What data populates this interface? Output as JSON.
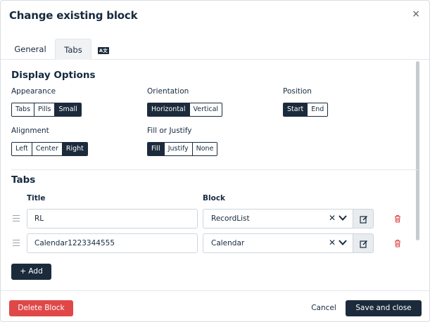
{
  "modal": {
    "title": "Change existing block",
    "close_symbol": "×"
  },
  "tabs": [
    {
      "label": "General"
    },
    {
      "label": "Tabs"
    },
    {
      "label": "A文",
      "icon": "translate-icon"
    }
  ],
  "display_options": {
    "heading": "Display Options",
    "appearance": {
      "label": "Appearance",
      "options": [
        "Tabs",
        "Pills",
        "Small"
      ],
      "selected": "Small"
    },
    "orientation": {
      "label": "Orientation",
      "options": [
        "Horizontal",
        "Vertical"
      ],
      "selected": "Horizontal"
    },
    "position": {
      "label": "Position",
      "options": [
        "Start",
        "End"
      ],
      "selected": "Start"
    },
    "alignment": {
      "label": "Alignment",
      "options": [
        "Left",
        "Center",
        "Right"
      ],
      "selected": "Right"
    },
    "fill_justify": {
      "label": "Fill or Justify",
      "options": [
        "Fill",
        "Justify",
        "None"
      ],
      "selected": "Fill"
    }
  },
  "tabs_section": {
    "heading": "Tabs",
    "col_title": "Title",
    "col_block": "Block",
    "rows": [
      {
        "title": "RL",
        "block": "RecordList"
      },
      {
        "title": "Calendar1223344555",
        "block": "Calendar"
      }
    ],
    "add_label": "+ Add"
  },
  "footer": {
    "delete_label": "Delete Block",
    "cancel_label": "Cancel",
    "save_label": "Save and close"
  },
  "colors": {
    "primary": "#1b2b3c",
    "danger": "#e04848",
    "text": "#162a3e",
    "border": "#cfd5db"
  }
}
